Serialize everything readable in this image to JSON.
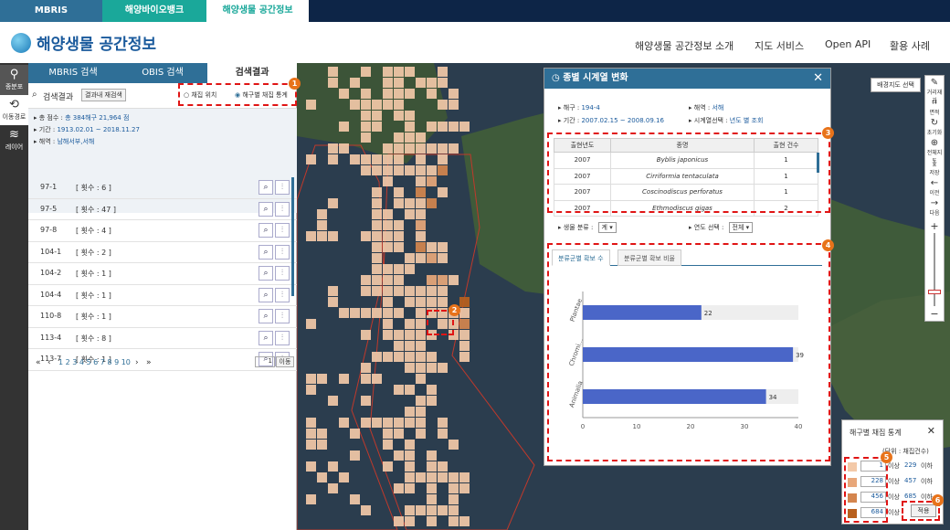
{
  "site_tabs": [
    "MBRIS",
    "해양바이오뱅크",
    "해양생물 공간정보"
  ],
  "logo_title": "해양생물 공간정보",
  "gnb": [
    "해양생물 공간정보 소개",
    "지도 서비스",
    "Open API",
    "활용 사례"
  ],
  "iconbar": [
    "종분포",
    "이동경로",
    "레이어"
  ],
  "left_tabs": [
    "MBRIS 검색",
    "OBIS 검색",
    "검색결과"
  ],
  "search": {
    "label": "검색결과",
    "button": "결과내 재검색",
    "option1": "채집 위치",
    "option2": "해구별 채집 통계"
  },
  "summary": {
    "total_label": "총 점수 : ",
    "total_value": "총 384해구 21,964 점",
    "period_label": "기간 : ",
    "period_value": "1913.02.01 ~ 2018.11.27",
    "sea_label": "해역 : ",
    "sea_value": "남해서부,서해"
  },
  "rows": [
    {
      "name": "97-1",
      "count": "[ 횟수 : 6 ]"
    },
    {
      "name": "97-5",
      "count": "[ 횟수 : 47 ]"
    },
    {
      "name": "97-8",
      "count": "[ 횟수 : 4 ]"
    },
    {
      "name": "104-1",
      "count": "[ 횟수 : 2 ]"
    },
    {
      "name": "104-2",
      "count": "[ 횟수 : 1 ]"
    },
    {
      "name": "104-4",
      "count": "[ 횟수 : 1 ]"
    },
    {
      "name": "110-8",
      "count": "[ 횟수 : 1 ]"
    },
    {
      "name": "113-4",
      "count": "[ 횟수 : 8 ]"
    },
    {
      "name": "113-7",
      "count": "[ 횟수 : 1 ]"
    }
  ],
  "pager": {
    "pages": "1 2 3 4 5 6 7 8 9 10",
    "input": "1",
    "go": "이동"
  },
  "dialog": {
    "title": "종별 시계열 변화",
    "grid_label": "해구 : ",
    "grid_value": "194-4",
    "sea_label": "해역 : ",
    "sea_value": "서해",
    "period_label": "기간 : ",
    "period_value": "2007.02.15 ~ 2008.09.16",
    "ts_label": "시계열선택 : ",
    "ts_value": "년도 별 조회",
    "table_headers": [
      "출현년도",
      "종명",
      "출현 건수"
    ],
    "table_rows": [
      [
        "2007",
        "Byblis japonicus",
        "1"
      ],
      [
        "2007",
        "Cirriformia tentaculata",
        "1"
      ],
      [
        "2007",
        "Coscinodiscus perforatus",
        "1"
      ],
      [
        "2007",
        "Ethmodiscus gigas",
        "2"
      ]
    ],
    "bio_label": "생물 분류 : ",
    "bio_value": "계",
    "year_label": "연도 선택 : ",
    "year_value": "전체",
    "chart_tabs": [
      "분류군별 확보 수",
      "분류군별 확보 비율"
    ]
  },
  "chart_data": {
    "type": "bar",
    "orientation": "horizontal",
    "categories": [
      "Plantae",
      "Chromi...",
      "Animalia"
    ],
    "values": [
      22,
      39,
      34
    ],
    "xlim": [
      0,
      40
    ],
    "xticks": [
      "0",
      "10",
      "20",
      "30",
      "40"
    ],
    "bar_color": "#4a66c8"
  },
  "stat": {
    "title": "해구별 채집 통계",
    "unit": "(단위 : 채집건수)",
    "rows": [
      {
        "from": "1",
        "to": "229",
        "color": "#f3c9a8"
      },
      {
        "from": "228",
        "to": "457",
        "color": "#e8a77a"
      },
      {
        "from": "456",
        "to": "685",
        "color": "#d4854e"
      },
      {
        "from": "684",
        "to": "",
        "color": "#b8601e"
      }
    ],
    "from_suffix": "이상",
    "to_suffix": "이하",
    "apply": "적용"
  },
  "base_map_button": "배경지도 선택",
  "right_tools": [
    "거리재기",
    "면적",
    "초기화",
    "전체지도",
    "저장",
    "이전",
    "다음"
  ],
  "badges": [
    "1",
    "2",
    "3",
    "4",
    "5",
    "6"
  ],
  "colors": {
    "navy": "#0d2547",
    "teal": "#1aa89a",
    "blue": "#2f6f97",
    "highlight": "#e01414"
  }
}
